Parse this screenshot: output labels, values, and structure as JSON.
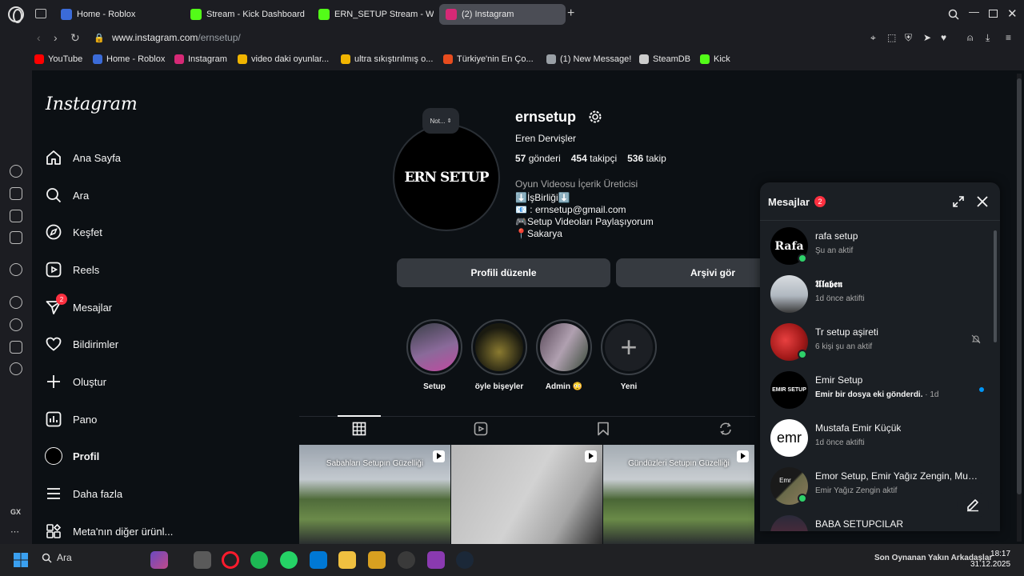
{
  "browser": {
    "tabs": [
      {
        "label": "Home - Roblox",
        "color": "#3b6bd8",
        "active": false
      },
      {
        "label": "Stream - Kick Dashboard",
        "color": "#53fc18",
        "active": false
      },
      {
        "label": "ERN_SETUP Stream - Wat",
        "color": "#53fc18",
        "active": false
      },
      {
        "label": "(2) Instagram",
        "color": "#d62976",
        "active": true
      }
    ],
    "url_domain": "www.instagram.com",
    "url_path": "/ernsetup/",
    "bookmarks": [
      {
        "label": "YouTube",
        "color": "#ff0000"
      },
      {
        "label": "Home - Roblox",
        "color": "#3b6bd8"
      },
      {
        "label": "Instagram",
        "color": "#d62976"
      },
      {
        "label": "video daki oyunlar...",
        "color": "#f0b400"
      },
      {
        "label": "ultra sıkıştırılmış o...",
        "color": "#f0b400"
      },
      {
        "label": "Türkiye'nin En Ço...",
        "color": "#e84c1e"
      },
      {
        "label": "(1) New Message!",
        "color": "#9aa0a6"
      },
      {
        "label": "SteamDB",
        "color": "#cccccc"
      },
      {
        "label": "Kick",
        "color": "#53fc18"
      }
    ],
    "sidebar_label_gx": "GX",
    "sidebar_more": "⋯"
  },
  "nav": {
    "logo": "Instagram",
    "items": [
      {
        "label": "Ana Sayfa",
        "icon": "home-icon"
      },
      {
        "label": "Ara",
        "icon": "search-icon"
      },
      {
        "label": "Keşfet",
        "icon": "explore-icon"
      },
      {
        "label": "Reels",
        "icon": "reels-icon"
      },
      {
        "label": "Mesajlar",
        "icon": "messenger-icon",
        "badge": "2"
      },
      {
        "label": "Bildirimler",
        "icon": "heart-icon"
      },
      {
        "label": "Oluştur",
        "icon": "plus-icon"
      },
      {
        "label": "Pano",
        "icon": "dashboard-icon"
      },
      {
        "label": "Profil",
        "icon": "profile-avatar-icon"
      },
      {
        "label": "Daha fazla",
        "icon": "menu-icon"
      },
      {
        "label": "Meta'nın diğer ürünl...",
        "icon": "meta-apps-icon"
      }
    ]
  },
  "profile": {
    "note": "Not...",
    "avatar_text": "ERN SETUP",
    "username": "ernsetup",
    "full_name": "Eren Dervişler",
    "posts_count": "57",
    "posts_label": "gönderi",
    "followers_count": "454",
    "followers_label": "takipçi",
    "following_count": "536",
    "following_label": "takip",
    "category": "Oyun Videosu İçerik Üreticisi",
    "bio": [
      "⬇️İşBirliği⬇️",
      "📧 : ernsetup@gmail.com",
      "🎮Setup Videoları Paylaşıyorum",
      "📍Sakarya"
    ],
    "edit_button": "Profili düzenle",
    "archive_button": "Arşivi gör"
  },
  "highlights": [
    {
      "label": "Setup"
    },
    {
      "label": "öyle bişeyler"
    },
    {
      "label": "Admin 😳"
    },
    {
      "label": "Yeni"
    }
  ],
  "posts": [
    {
      "caption": "Sabahları Setupın Güzelliği"
    },
    {
      "caption": ""
    },
    {
      "caption": "Gündüzleri Setupın Güzelliği"
    }
  ],
  "messages": {
    "title": "Mesajlar",
    "badge": "2",
    "conversations": [
      {
        "name": "rafa setup",
        "status": "Şu an aktif",
        "avatar_text": "Rafa",
        "online": true
      },
      {
        "name": "𝖀𝖑𝖆𝖇𝖊𝖓",
        "status": "1d önce aktifti",
        "avatar_text": "",
        "online": false
      },
      {
        "name": "Tr setup aşireti",
        "status": "6 kişi şu an aktif",
        "avatar_text": "",
        "online": true
      },
      {
        "name": "Emir Setup",
        "status_bold": "Emir bir dosya eki gönderdi.",
        "status": " · 1d",
        "avatar_text": "EMIR SETUP",
        "online": false,
        "unread": true
      },
      {
        "name": "Mustafa Emir Küçük",
        "status": "1d önce aktifti",
        "avatar_text": "emr",
        "online": false
      },
      {
        "name": "Emor Setup, Emir Yağız Zengin, Must...",
        "status": "Emir Yağız Zengin aktif",
        "avatar_text": "Emr",
        "online": true
      },
      {
        "name": "BABA SETUPCILAR",
        "status": "",
        "avatar_text": "",
        "online": false
      }
    ]
  },
  "taskbar": {
    "search": "Ara",
    "tray_text": "Son Oynanan Yakın Arkadaşlar",
    "time": "18:17",
    "date": "31.12.2025"
  }
}
